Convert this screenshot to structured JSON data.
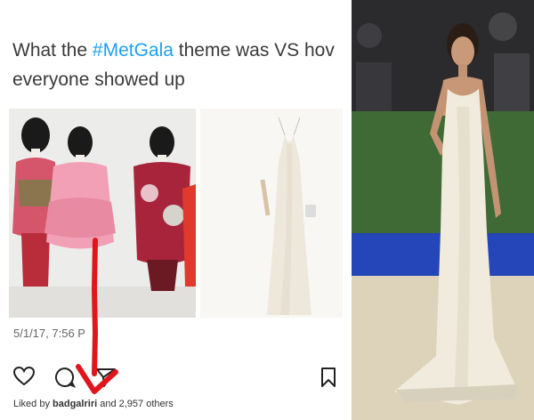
{
  "tweet": {
    "line1_prefix": "What the ",
    "hashtag": "#MetGala",
    "line1_suffix": " theme was VS hov",
    "line2": "everyone showed up"
  },
  "post": {
    "date": "5/1/17, 7:56 P",
    "likes_prefix": "Liked by ",
    "likes_user": "badgalriri",
    "likes_suffix": " and 2,957 others"
  },
  "icons": [
    "heart-icon",
    "comment-icon",
    "share-icon",
    "bookmark-icon"
  ],
  "colors": {
    "hashtag": "#1da1f2",
    "arrow": "#e0161c",
    "dress": "#f1ece0"
  }
}
